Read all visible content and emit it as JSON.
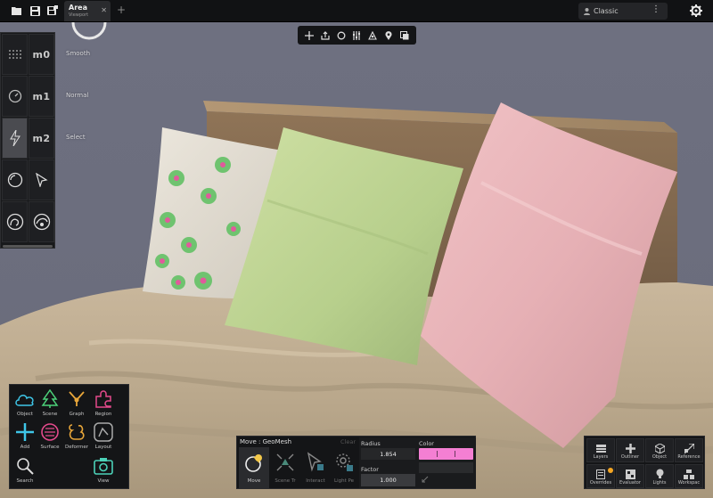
{
  "tab": {
    "title": "Area",
    "subtitle": "Viewport"
  },
  "workspace": {
    "label": "Classic"
  },
  "modes": [
    {
      "code": "m0",
      "label": "Smooth"
    },
    {
      "code": "m1",
      "label": "Normal"
    },
    {
      "code": "m2",
      "label": "Select"
    }
  ],
  "bottom_left": {
    "items": [
      {
        "label": "Object",
        "color": "#3ec6e8"
      },
      {
        "label": "Scene",
        "color": "#4cd27a"
      },
      {
        "label": "Graph",
        "color": "#e8a63a"
      },
      {
        "label": "Region",
        "color": "#e44a8c"
      },
      {
        "label": "Add",
        "color": "#3ec6e8"
      },
      {
        "label": "Surface",
        "color": "#e44a8c"
      },
      {
        "label": "Deformer",
        "color": "#e8a63a"
      },
      {
        "label": "Layout",
        "color": "#aaaaaa"
      },
      {
        "label": "Search",
        "color": "#dddddd"
      },
      {
        "label": "View",
        "color": "#4cd2b8"
      }
    ]
  },
  "tool_panel": {
    "title": "Move : GeoMesh",
    "clear_label": "Clear",
    "tools": [
      {
        "label": "Move"
      },
      {
        "label": "Scene Tr"
      },
      {
        "label": "Interact"
      },
      {
        "label": "Light Pe"
      }
    ],
    "radius_label": "Radius",
    "radius_value": "1.854",
    "color_label": "Color",
    "color_value": "#f47fd3",
    "factor_label": "Factor",
    "factor_value": "1.000"
  },
  "bottom_right": {
    "items": [
      {
        "label": "Layers"
      },
      {
        "label": "Outliner"
      },
      {
        "label": "Object"
      },
      {
        "label": "Reference"
      },
      {
        "label": "Overrides"
      },
      {
        "label": "Evaluator"
      },
      {
        "label": "Lights"
      },
      {
        "label": "Workspac"
      }
    ]
  }
}
